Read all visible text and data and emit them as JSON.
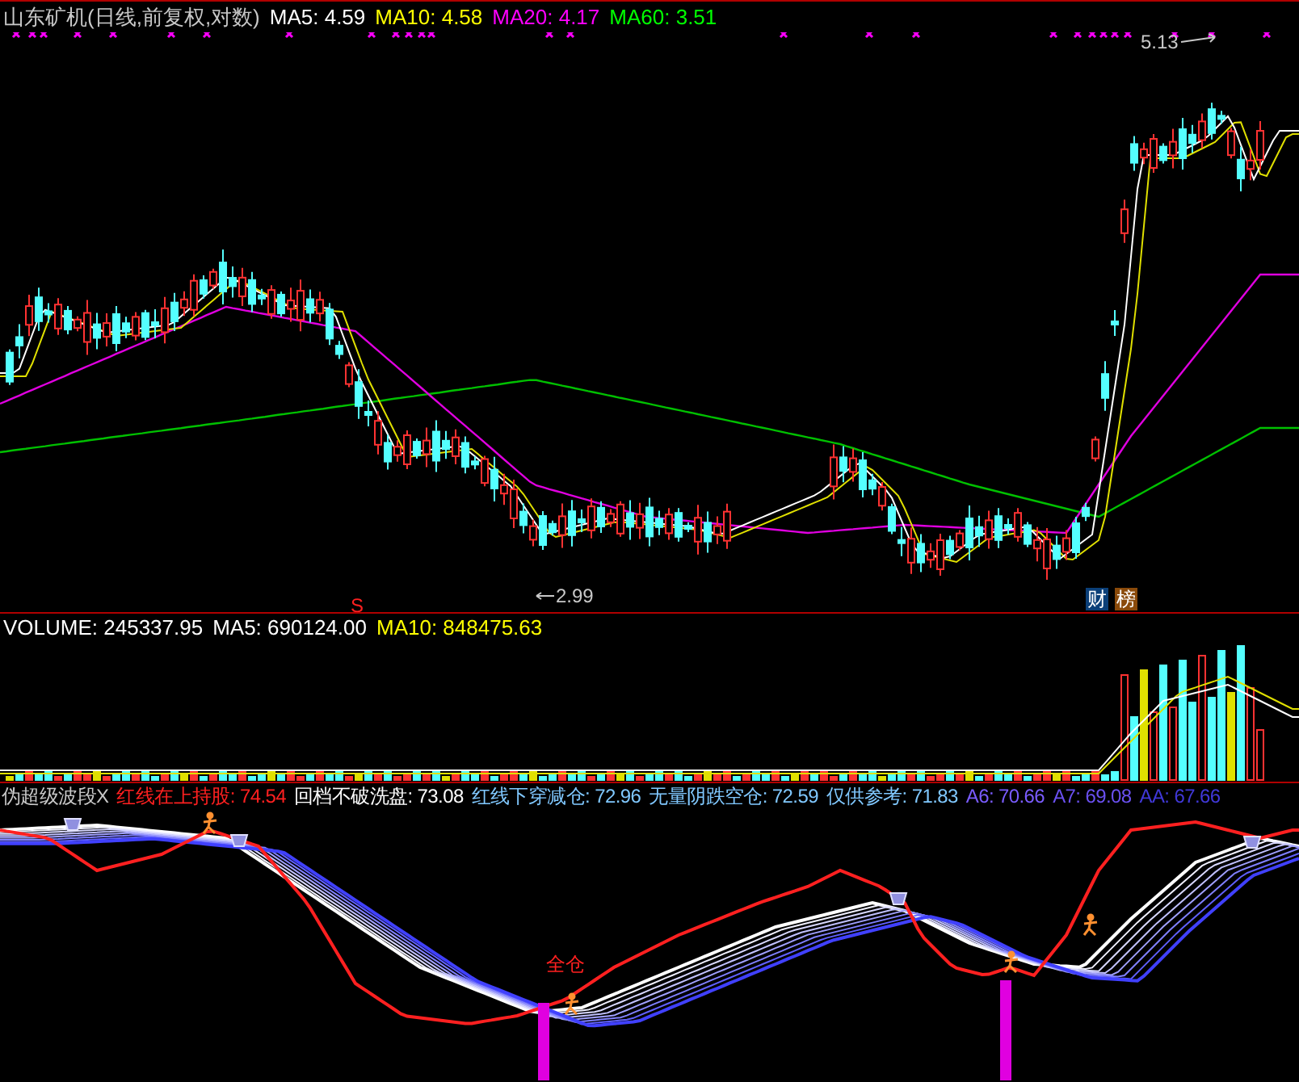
{
  "price_panel": {
    "title": "山东矿机(日线,前复权,对数)",
    "indicators": [
      {
        "label": "MA5: 4.59",
        "color": "#ffffff"
      },
      {
        "label": "MA10: 4.58",
        "color": "#ffff00"
      },
      {
        "label": "MA20: 4.17",
        "color": "#ff00ff"
      },
      {
        "label": "MA60: 3.51",
        "color": "#00ff00"
      }
    ],
    "high_label": "5.13",
    "low_label": "2.99",
    "signal_mark": "S",
    "badges": [
      {
        "text": "财",
        "color": "#0b3f78"
      },
      {
        "text": "榜",
        "color": "#8a4a0a"
      }
    ]
  },
  "volume_panel": {
    "indicators": [
      {
        "label": "VOLUME: 245337.95",
        "color": "#ffffff"
      },
      {
        "label": "MA5: 690124.00",
        "color": "#ffffff"
      },
      {
        "label": "MA10: 848475.63",
        "color": "#ffff00"
      }
    ]
  },
  "oscillator_panel": {
    "title": "伪超级波段X",
    "indicators": [
      {
        "label": "红线在上持股: 74.54",
        "color": "#ff2020"
      },
      {
        "label": "回档不破洗盘: 73.08",
        "color": "#ffffff"
      },
      {
        "label": "红线下穿减仓: 72.96",
        "color": "#80c8ff"
      },
      {
        "label": "无量阴跌空仓: 72.59",
        "color": "#80c8ff"
      },
      {
        "label": "仅供参考: 71.83",
        "color": "#80c8ff"
      },
      {
        "label": "A6: 70.66",
        "color": "#7a5cff"
      },
      {
        "label": "A7: 69.08",
        "color": "#6a50f0"
      },
      {
        "label": "AA: 67.66",
        "color": "#4038d8"
      }
    ],
    "signal_label": "全仓"
  }
}
